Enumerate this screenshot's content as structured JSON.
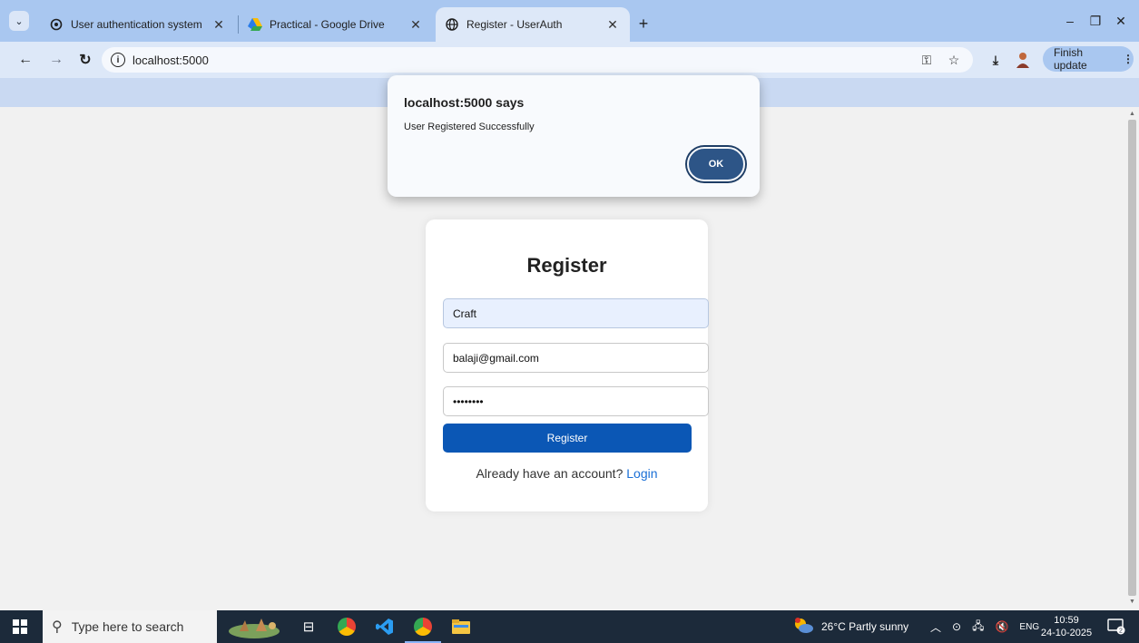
{
  "browser": {
    "tabs": [
      {
        "title": "User authentication system",
        "icon": "openai-icon",
        "active": false
      },
      {
        "title": "Practical - Google Drive",
        "icon": "google-drive-icon",
        "active": false
      },
      {
        "title": "Register - UserAuth",
        "icon": "globe-icon",
        "active": true
      }
    ],
    "address": "localhost:5000",
    "finish_update": "Finish update"
  },
  "dialog": {
    "title": "localhost:5000 says",
    "message": "User Registered Successfully",
    "ok_label": "OK"
  },
  "form": {
    "heading": "Register",
    "name_value": "Craft",
    "email_value": "balaji@gmail.com",
    "password_value": "password",
    "submit_label": "Register",
    "login_prompt": "Already have an account?",
    "login_link": "Login"
  },
  "taskbar": {
    "search_placeholder": "Type here to search",
    "weather": "26°C  Partly sunny",
    "language": "ENG",
    "time": "10:59",
    "date": "24-10-2025"
  },
  "colors": {
    "tabstrip": "#a9c7f0",
    "toolbar": "#dde8f8",
    "primary_button": "#0b57b5",
    "link": "#1a6fd6",
    "dialog_ok": "#2d5587",
    "taskbar": "#1c2a3a"
  }
}
